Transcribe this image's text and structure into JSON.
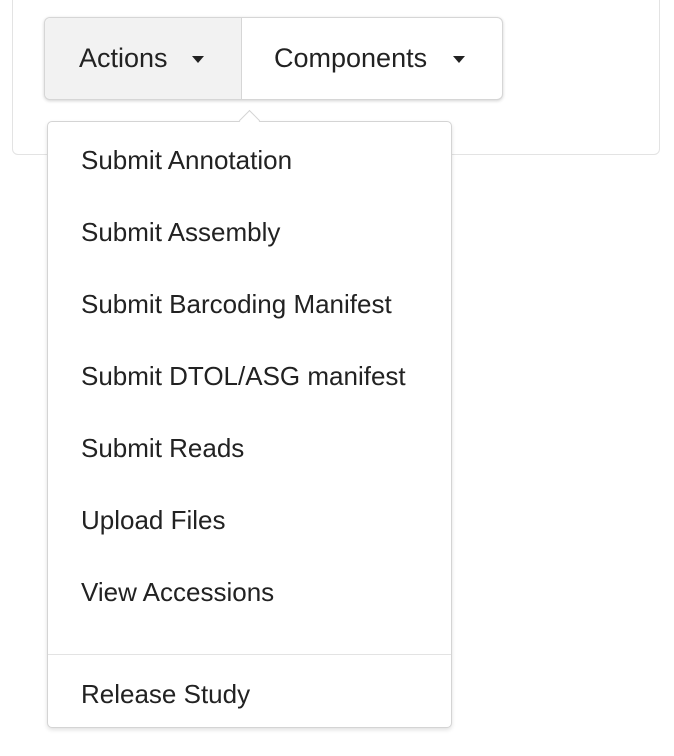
{
  "toolbar": {
    "actions_label": "Actions",
    "components_label": "Components"
  },
  "dropdown": {
    "items": [
      {
        "label": "Submit Annotation"
      },
      {
        "label": "Submit Assembly"
      },
      {
        "label": "Submit Barcoding Manifest"
      },
      {
        "label": "Submit DTOL/ASG manifest"
      },
      {
        "label": "Submit Reads"
      },
      {
        "label": "Upload Files"
      },
      {
        "label": "View Accessions"
      }
    ],
    "footer_item": {
      "label": "Release Study"
    }
  },
  "icons": {
    "actions_caret": "caret-down-icon",
    "components_caret": "caret-down-icon"
  }
}
